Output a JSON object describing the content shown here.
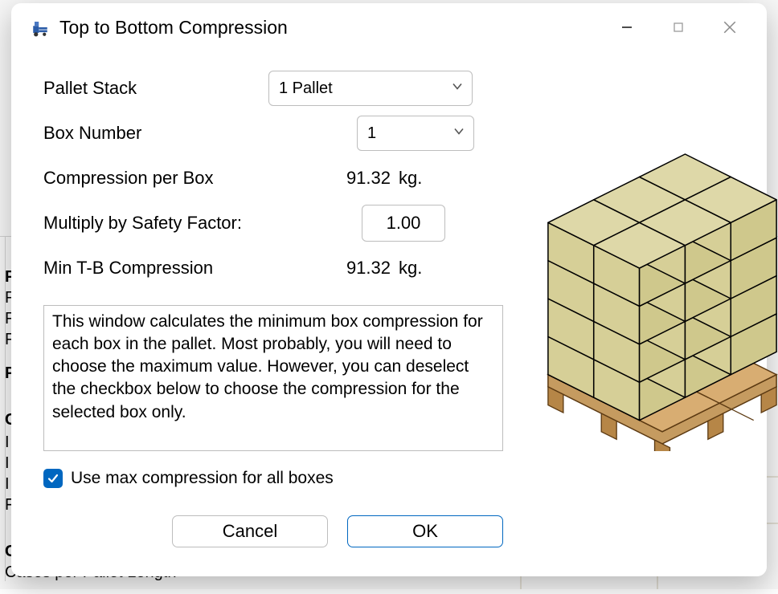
{
  "window": {
    "title": "Top to Bottom Compression"
  },
  "form": {
    "pallet_stack_label": "Pallet Stack",
    "pallet_stack_value": "1 Pallet",
    "box_number_label": "Box Number",
    "box_number_value": "1",
    "compression_label": "Compression per Box",
    "compression_value": "91.32",
    "compression_unit": "kg.",
    "safety_label": "Multiply by Safety Factor:",
    "safety_value": "1.00",
    "min_tb_label": "Min T-B Compression",
    "min_tb_value": "91.32",
    "min_tb_unit": "kg.",
    "description": "This window calculates the minimum box compression for each box in the pallet. Most probably, you will need to choose the maximum value. However, you can deselect the checkbox below to choose the compression for the selected box only.",
    "checkbox_label": "Use max compression for all boxes",
    "checkbox_checked": true
  },
  "buttons": {
    "cancel": "Cancel",
    "ok": "OK"
  },
  "background": {
    "sidebar_letters": [
      "P",
      "P",
      "P",
      "P",
      "P",
      "P",
      "C",
      "I",
      "I",
      "I",
      "F",
      "C"
    ],
    "bottom_line": "Cases per Pallet Length"
  }
}
